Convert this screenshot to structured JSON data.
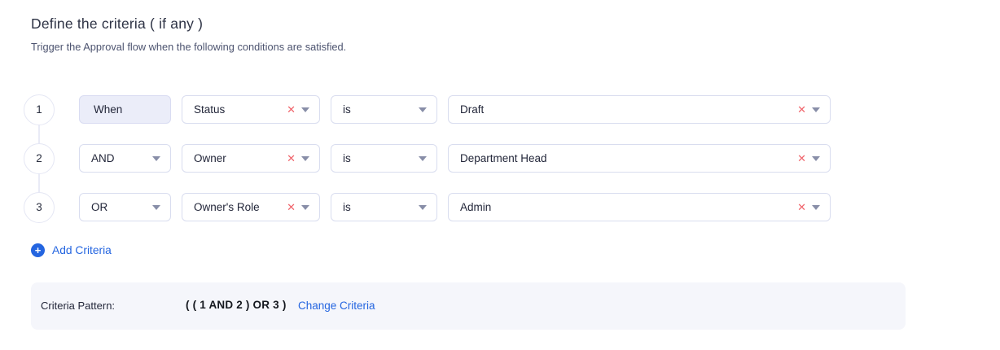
{
  "header": {
    "title": "Define the criteria ( if any )",
    "subtitle": "Trigger the Approval flow when the following conditions are satisfied."
  },
  "rows": [
    {
      "index": "1",
      "connector": "When",
      "field": "Status",
      "operator": "is",
      "value": "Draft"
    },
    {
      "index": "2",
      "connector": "AND",
      "field": "Owner",
      "operator": "is",
      "value": "Department Head"
    },
    {
      "index": "3",
      "connector": "OR",
      "field": "Owner's Role",
      "operator": "is",
      "value": "Admin"
    }
  ],
  "icons": {
    "clear": "✕",
    "plus": "+",
    "chevron_down": "caret-down",
    "clear_color": "#f0646b",
    "caret_color": "#888ea8"
  },
  "add_criteria": {
    "label": "Add Criteria"
  },
  "pattern": {
    "label": "Criteria Pattern:",
    "value": "( ( 1 AND 2 ) OR 3 )",
    "link": "Change Criteria"
  },
  "colors": {
    "accent_blue": "#2465e0",
    "danger_red": "#f0646b",
    "pattern_bar_bg": "#f5f6fb",
    "box_border": "#d9ddef",
    "when_chip_bg": "#ebedf9"
  }
}
